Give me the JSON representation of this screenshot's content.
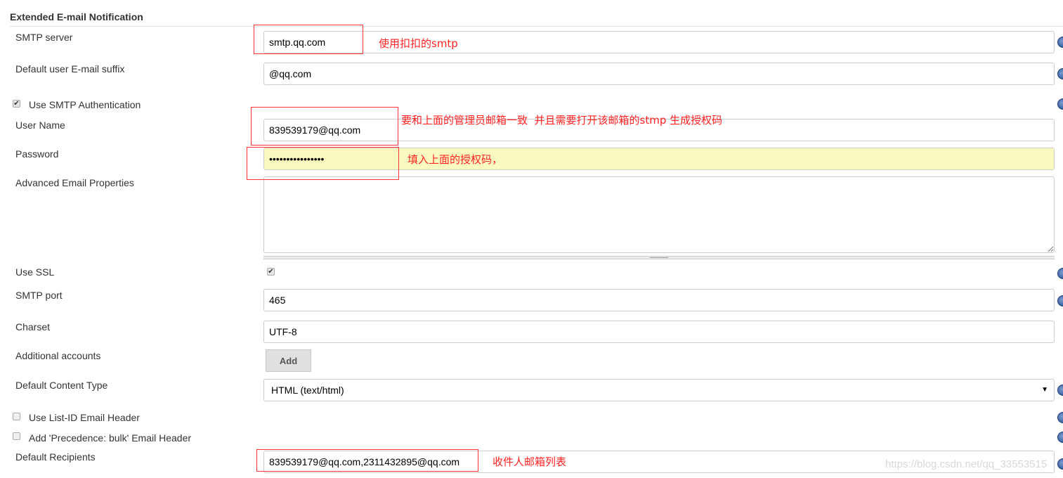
{
  "section_title": "Extended E-mail Notification",
  "fields": {
    "smtp_server": {
      "label": "SMTP server",
      "value": "smtp.qq.com"
    },
    "email_suffix": {
      "label": "Default user E-mail suffix",
      "value": "@qq.com"
    },
    "use_smtp_auth": {
      "label": "Use SMTP Authentication",
      "checked": true
    },
    "user_name": {
      "label": "User Name",
      "value": "839539179@qq.com"
    },
    "password": {
      "label": "Password",
      "value": "................"
    },
    "advanced_props": {
      "label": "Advanced Email Properties",
      "value": ""
    },
    "use_ssl": {
      "label": "Use SSL",
      "checked": true
    },
    "smtp_port": {
      "label": "SMTP port",
      "value": "465"
    },
    "charset": {
      "label": "Charset",
      "value": "UTF-8"
    },
    "additional_accounts": {
      "label": "Additional accounts",
      "button": "Add"
    },
    "content_type": {
      "label": "Default Content Type",
      "value": "HTML (text/html)"
    },
    "list_id_header": {
      "label": "Use List-ID Email Header",
      "checked": false
    },
    "precedence_header": {
      "label": "Add 'Precedence: bulk' Email Header",
      "checked": false
    },
    "default_recipients": {
      "label": "Default Recipients",
      "value": "839539179@qq.com,2311432895@qq.com"
    }
  },
  "annotations": {
    "smtp": "使用扣扣的smtp",
    "username": "要和上面的管理员邮箱一致  并且需要打开该邮箱的stmp 生成授权码",
    "password": "填入上面的授权码，",
    "recipients": "收件人邮箱列表"
  },
  "watermark": "https://blog.csdn.net/qq_33553515",
  "colors": {
    "annotation": "#ff2222",
    "password_bg": "#fafac0",
    "help_icon": "#1f4b8f"
  },
  "icons": {
    "help": "help-icon",
    "select_caret": "caret-down-icon"
  }
}
